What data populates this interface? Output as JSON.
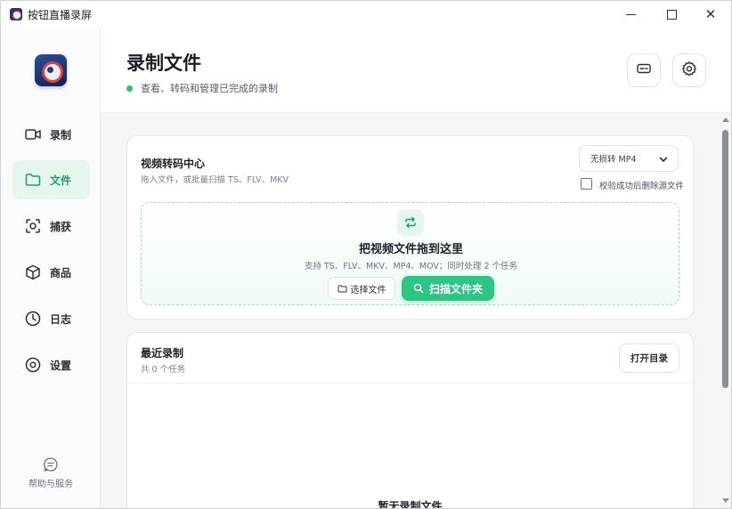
{
  "window": {
    "title": "按钮直播录屏"
  },
  "sidebar": {
    "items": [
      {
        "label": "录制",
        "icon": "video-camera-icon"
      },
      {
        "label": "文件",
        "icon": "folder-icon",
        "active": true
      },
      {
        "label": "捕获",
        "icon": "scan-capture-icon"
      },
      {
        "label": "商品",
        "icon": "box-icon"
      },
      {
        "label": "日志",
        "icon": "clock-icon"
      },
      {
        "label": "设置",
        "icon": "gear-icon"
      }
    ],
    "help_label": "帮助与服务"
  },
  "header": {
    "title": "录制文件",
    "subtitle": "查看、转码和管理已完成的录制"
  },
  "transcode": {
    "title": "视频转码中心",
    "subtitle": "拖入文件，或批量扫描 TS、FLV、MKV",
    "select_value": "无损转 MP4",
    "checkbox_label": "校验成功后删除源文件",
    "checkbox_checked": false,
    "dropzone": {
      "title": "把视频文件拖到这里",
      "subtitle": "支持 TS、FLV、MKV、MP4、MOV；同时处理 2 个任务",
      "choose_label": "选择文件",
      "scan_label": "扫描文件夹"
    }
  },
  "recent": {
    "title": "最近录制",
    "subtitle": "共 0 个任务",
    "open_label": "打开目录",
    "empty_text": "暂无录制文件"
  },
  "colors": {
    "accent": "#2cc584",
    "accent_text": "#16a36a",
    "active_bg": "#e6f6ee",
    "status_dot": "#22c55e"
  }
}
